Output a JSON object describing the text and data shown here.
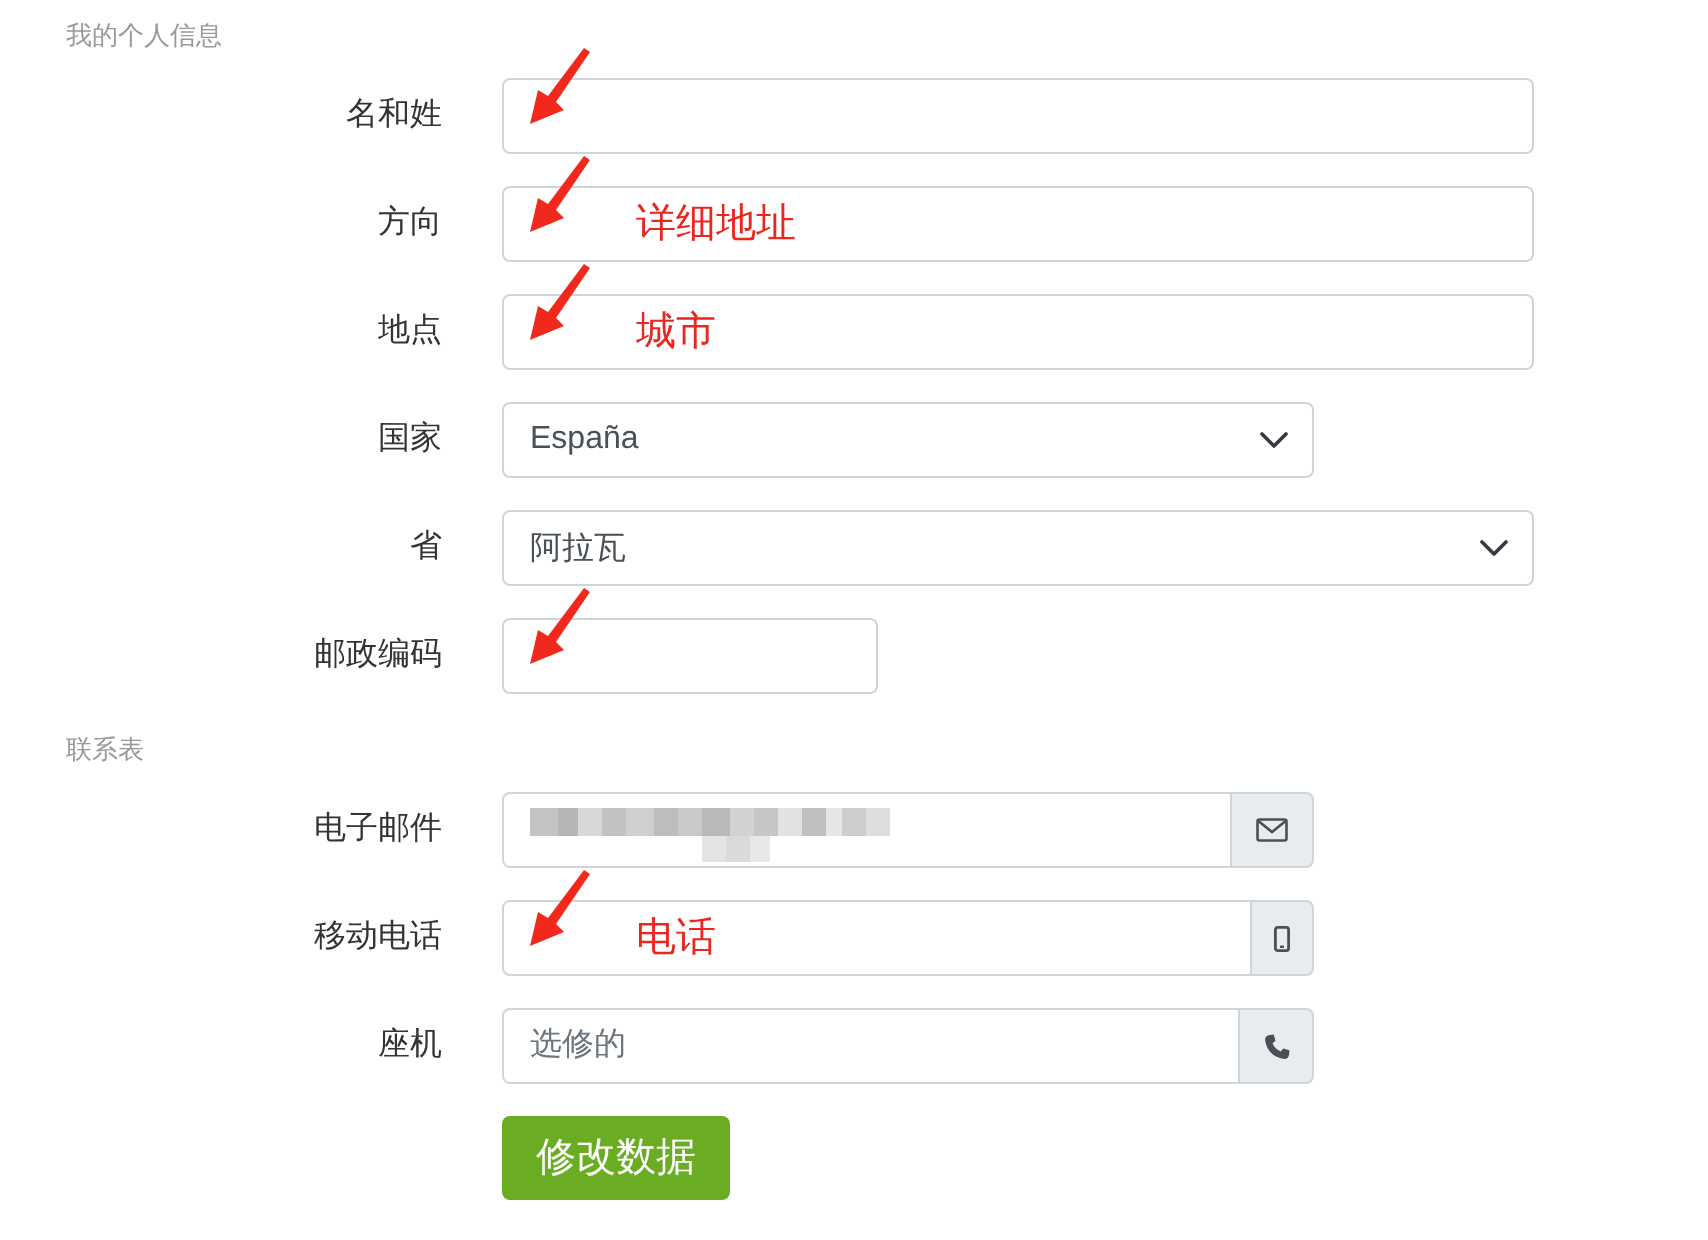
{
  "sections": [
    {
      "heading": "我的个人信息",
      "fields": [
        {
          "label": "名和姓",
          "kind": "text",
          "arrow": true,
          "redacted": false
        },
        {
          "label": "方向",
          "kind": "text",
          "arrow": true,
          "redacted": false,
          "note": "详细地址"
        },
        {
          "label": "地点",
          "kind": "text",
          "arrow": true,
          "redacted": false,
          "note": "城市"
        },
        {
          "label": "国家",
          "kind": "select",
          "arrow": false,
          "redacted": false,
          "value": "España"
        },
        {
          "label": "省",
          "kind": "select",
          "arrow": false,
          "redacted": false,
          "value": "阿拉瓦"
        },
        {
          "label": "邮政编码",
          "kind": "text",
          "arrow": true,
          "redacted": false
        }
      ]
    },
    {
      "heading": "联系表",
      "fields": [
        {
          "label": "电子邮件",
          "kind": "email",
          "arrow": false,
          "redacted": true
        },
        {
          "label": "移动电话",
          "kind": "mobile",
          "arrow": true,
          "redacted": false,
          "note": "电话"
        },
        {
          "label": "座机",
          "kind": "phone",
          "arrow": false,
          "redacted": false,
          "placeholder": "选修的"
        }
      ]
    }
  ],
  "submit_button": {
    "label": "修改数据"
  }
}
